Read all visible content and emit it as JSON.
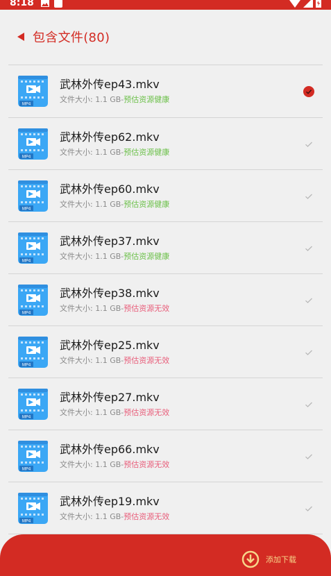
{
  "status_bar": {
    "time": "8:18"
  },
  "header": {
    "title": "包含文件(80)"
  },
  "files": [
    {
      "name": "武林外传ep43.mkv",
      "size_label": "文件大小: 1.1 GB-",
      "status": "预估资源健康",
      "healthy": true,
      "selected": true
    },
    {
      "name": "武林外传ep62.mkv",
      "size_label": "文件大小: 1.1 GB-",
      "status": "预估资源健康",
      "healthy": true,
      "selected": false
    },
    {
      "name": "武林外传ep60.mkv",
      "size_label": "文件大小: 1.1 GB-",
      "status": "预估资源健康",
      "healthy": true,
      "selected": false
    },
    {
      "name": "武林外传ep37.mkv",
      "size_label": "文件大小: 1.1 GB-",
      "status": "预估资源健康",
      "healthy": true,
      "selected": false
    },
    {
      "name": "武林外传ep38.mkv",
      "size_label": "文件大小: 1.1 GB-",
      "status": "预估资源无效",
      "healthy": false,
      "selected": false
    },
    {
      "name": "武林外传ep25.mkv",
      "size_label": "文件大小: 1.1 GB-",
      "status": "预估资源无效",
      "healthy": false,
      "selected": false
    },
    {
      "name": "武林外传ep27.mkv",
      "size_label": "文件大小: 1.1 GB-",
      "status": "预估资源无效",
      "healthy": false,
      "selected": false
    },
    {
      "name": "武林外传ep66.mkv",
      "size_label": "文件大小: 1.1 GB-",
      "status": "预估资源无效",
      "healthy": false,
      "selected": false
    },
    {
      "name": "武林外传ep19.mkv",
      "size_label": "文件大小: 1.1 GB-",
      "status": "预估资源无效",
      "healthy": false,
      "selected": false
    }
  ],
  "file_icon_badge": "MP4",
  "bottom_bar": {
    "download_label": "添加下载"
  },
  "colors": {
    "accent": "#d32b23",
    "healthy": "#6cc04a",
    "invalid": "#e85d7a",
    "icon_blue": "#3ba7f5"
  }
}
